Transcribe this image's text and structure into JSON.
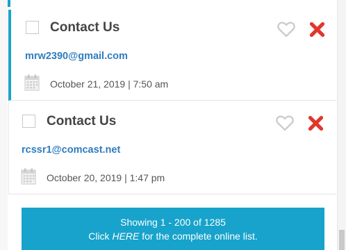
{
  "messages": [
    {
      "title": "Contact Us",
      "email": "mrw2390@gmail.com",
      "date": "October 21, 2019 | 7:50 am",
      "selected": true
    },
    {
      "title": "Contact Us",
      "email": "rcssr1@comcast.net",
      "date": "October 20, 2019 | 1:47 pm",
      "selected": false
    }
  ],
  "icons": {
    "favorite": "heart-outline-icon",
    "delete": "x-icon",
    "date": "calendar-icon"
  },
  "colors": {
    "accent": "#1aa3c8",
    "link": "#2f7dbf",
    "delete": "#e2362b",
    "heart": "#cccccc"
  },
  "footer": {
    "showing": "Showing 1 - 200 of 1285",
    "click_prefix": "Click ",
    "here_link": "HERE",
    "click_suffix": " for the complete online list."
  }
}
